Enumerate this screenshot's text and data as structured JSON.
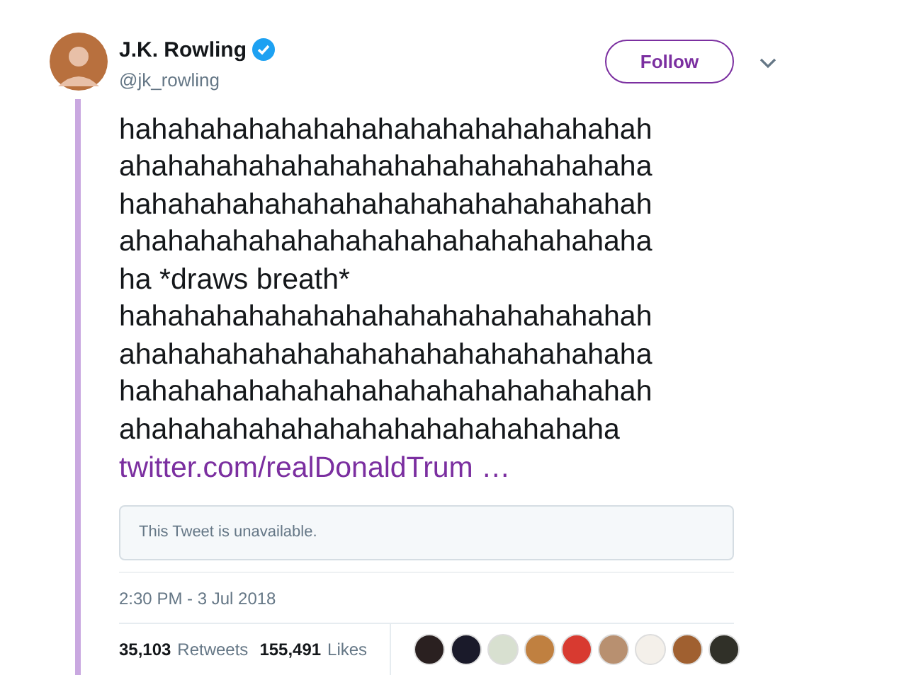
{
  "author": {
    "name": "J.K. Rowling",
    "handle": "@jk_rowling",
    "verified": true
  },
  "follow_button": {
    "label": "Follow"
  },
  "tweet_lines": [
    "hahahahahahahahahahahahahahahahah",
    "ahahahahahahahahahahahahahahahaha",
    "hahahahahahahahahahahahahahahahah",
    "ahahahahahahahahahahahahahahahaha",
    "ha *draws breath*",
    "hahahahahahahahahahahahahahahahah",
    "ahahahahahahahahahahahahahahahaha",
    "hahahahahahahahahahahahahahahahah",
    "ahahahahahahahahahahahahahahaha"
  ],
  "link": "twitter.com/realDonaldTrum …",
  "quoted_notice": "This Tweet is unavailable.",
  "timestamp": "2:30 PM - 3 Jul 2018",
  "stats": [
    {
      "count": "35,103",
      "label": "Retweets"
    },
    {
      "count": "155,491",
      "label": "Likes"
    }
  ],
  "likers": [
    {
      "color": "#2a2020"
    },
    {
      "color": "#1a1a2a"
    },
    {
      "color": "#d8e0d0"
    },
    {
      "color": "#c08040"
    },
    {
      "color": "#d83a30"
    },
    {
      "color": "#b89070"
    },
    {
      "color": "#f4f0ea"
    },
    {
      "color": "#a06030"
    },
    {
      "color": "#303028"
    }
  ]
}
